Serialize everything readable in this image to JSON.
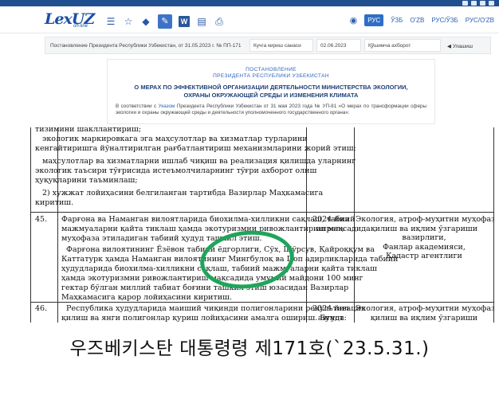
{
  "header": {
    "logo": "LexUZ",
    "logo_sub": "on-line",
    "languages": [
      "РУС",
      "ЎЗБ",
      "O'ZB",
      "РУС/ЎЗБ",
      "РУС/O'ZB"
    ],
    "active_language": "РУС"
  },
  "docbar": {
    "doc_title": "Постановление Президента Республики Узбекистан, от 31.05.2023 г. № ПП-171",
    "field_label": "Кучга кириш санаси",
    "field_value": "02.06.2023",
    "search_placeholder": "Қўшимча ахборот",
    "share": "Улашиш"
  },
  "title": {
    "ann1": "ПОСТАНОВЛЕНИЕ",
    "ann2": "ПРЕЗИДЕНТА РЕСПУБЛИКИ УЗБЕКИСТАН",
    "heading": "О МЕРАХ ПО ЭФФЕКТИВНОЙ ОРГАНИЗАЦИИ ДЕЯТЕЛЬНОСТИ МИНИСТЕРСТВА ЭКОЛОГИИ, ОХРАНЫ ОКРУЖАЮЩЕЙ СРЕДЫ И ИЗМЕНЕНИЯ КЛИМАТА",
    "para_a": "В соответствии с ",
    "para_link": "Указом",
    "para_b": " Президента Республики Узбекистан от 31 мая 2023 года № УП-81 «О мерах по трансформации сферы экологии и охраны окружающей среды и деятельности уполномоченного государственного органа»:"
  },
  "scan": {
    "lines_top": [
      "тизимини шакллантириш;",
      "экологик маркировкага эга маҳсулотлар ва хизматлар турларини",
      "кенгайтиришга йўналтирилган рағбатлантириш механизмларини жорий этиш;",
      "маҳсулотлар ва хизматларни ишлаб чиқиш ва реализация қилишда уларнинг",
      "экологик таъсири тўғрисида истеъмолчиларнинг тўғри ахборот олиш",
      "ҳуқуқларини таъминлаш;",
      "2) хужжат лойиҳасини белгиланган тартибда Вазирлар Маҳкамасига",
      "киритиш."
    ],
    "row45_no": "45.",
    "row45_lines": [
      "Фарғона ва Наманган вилоятларида биохилма-хилликни сақлаш, табиий",
      "мажмуаларни қайта тиклаш ҳамда экотуризмни ривожлантириш мақсадида",
      "муҳофаза этиладиган табиий ҳудуд ташкил этиш.",
      "Фарғона вилоятининг Ёзёвон табиий ёдгорлиги, Сўх, Шўрсув, Қайроққум ва",
      "Каттатурк ҳамда Наманган вилоятининг Мингбулоқ ва Поп адирликларида табиий",
      "ҳудудларида биохилма-хилликни сақлаш, табиий мажмуаларни қайта тиклаш",
      "ҳамда экотуризмни ривожлантириш мақсадида умумий майдони 100 минг",
      "гектар бўлган миллий табиат боғини ташкил этиш юзасидан Вазирлар",
      "Маҳкамасига қарор лойиҳасини киритиш."
    ],
    "row45_date": "2024 йил\nапрель",
    "row45_resp": "Экология, атроф-муҳитни муҳофаза\nқилиш ва иқлим ўзгариши\nвазирлиги,\nФанлар академияси,\nКадастр агентлиги",
    "row46_no": "46.",
    "row46_lines": [
      "Республика ҳудудларида маиший чиқинди полигонларини рекультивация",
      "қилиш ва янги полигонлар қуриш лойиҳасини амалга ошириш. Бунда:"
    ],
    "row46_date": "2024 йил\nавгуст",
    "row46_resp": "Экология, атроф-муҳитни муҳофаза\nқилиш ва иқлим ўзгариши"
  },
  "caption": "우즈베키스탄 대통령령 제171호(`23.5.31.)",
  "colors": {
    "accent": "#2f6ec6",
    "ring": "#1fa55b",
    "brand": "#1d4fa3"
  }
}
